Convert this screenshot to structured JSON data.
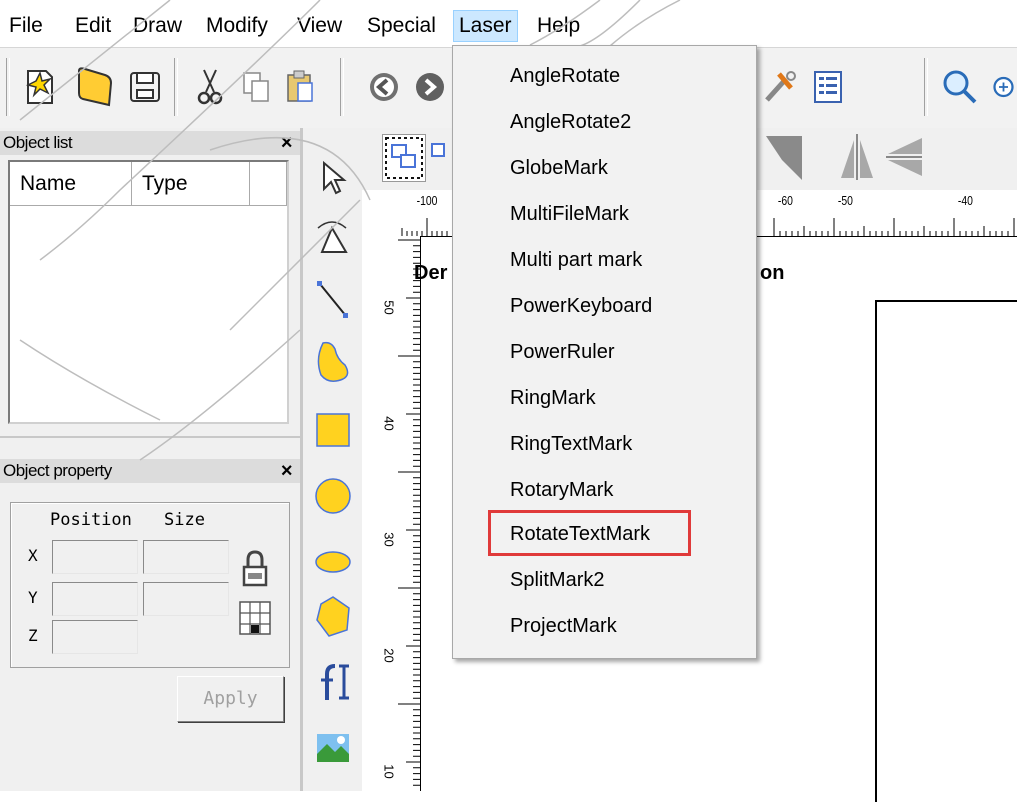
{
  "menubar": {
    "items": [
      "File",
      "Edit",
      "Draw",
      "Modify",
      "View",
      "Special",
      "Laser",
      "Help"
    ],
    "active": "Laser"
  },
  "toolbar": {
    "icons": [
      "new-file-icon",
      "open-folder-icon",
      "save-icon",
      "cut-icon",
      "copy-icon",
      "paste-icon",
      "undo-icon",
      "redo-icon",
      "tools-icon",
      "list-icon",
      "zoom-icon"
    ]
  },
  "object_list": {
    "title": "Object list",
    "close": "×",
    "columns": [
      "Name",
      "Type"
    ]
  },
  "object_property": {
    "title": "Object property",
    "close": "×",
    "position_label": "Position",
    "size_label": "Size",
    "x_label": "X",
    "y_label": "Y",
    "z_label": "Z",
    "apply_label": "Apply"
  },
  "ruler": {
    "h_labels": [
      "-100",
      "-60",
      "-50",
      "-40"
    ],
    "v_labels": [
      "50",
      "40",
      "30",
      "20",
      "10"
    ]
  },
  "canvas": {
    "partial_text_left": "Der",
    "partial_text_right": "on"
  },
  "laser_menu": {
    "items": [
      "AngleRotate",
      "AngleRotate2",
      "GlobeMark",
      "MultiFileMark",
      "Multi part mark",
      "PowerKeyboard",
      "PowerRuler",
      "RingMark",
      "RingTextMark",
      "RotaryMark",
      "RotateTextMark",
      "SplitMark2",
      "ProjectMark"
    ],
    "highlighted": "RotateTextMark",
    "highlight_color": "#e03a3a"
  },
  "colors": {
    "menu_active_bg": "#cce8ff",
    "shape_fill": "#ffd21f",
    "shape_stroke": "#4a74d8"
  }
}
